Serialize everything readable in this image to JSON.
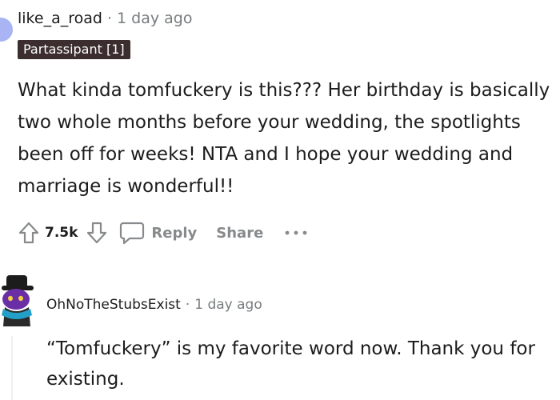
{
  "comment": {
    "username": "like_a_road",
    "separator": "·",
    "time": "1 day ago",
    "flair": "Partassipant [1]",
    "body": "What kinda tomfuckery is this??? Her birthday is basically two whole months before your wedding, the spotlights been off for weeks! NTA and I hope your wedding and marriage is wonderful!!",
    "actions": {
      "upvote_icon": "upvote-arrow-icon",
      "vote_count": "7.5k",
      "downvote_icon": "downvote-arrow-icon",
      "reply_icon": "speech-bubble-icon",
      "reply_label": "Reply",
      "share_label": "Share",
      "more_icon": "more-dots-icon"
    }
  },
  "reply": {
    "username": "OhNoTheStubsExist",
    "separator": "·",
    "time": "1 day ago",
    "body": "“Tomfuckery” is my favorite word now. Thank you for existing.",
    "avatar_icon": "snoo-avatar-icon"
  },
  "colors": {
    "text": "#1c1c1c",
    "muted": "#787c7e",
    "action": "#878a8c",
    "flair_bg": "#3c2e2e",
    "flair_text": "#ffffff",
    "avatar_hat": "#1c1c1c",
    "avatar_face": "#6a2fa6",
    "avatar_scarf": "#24a0c8"
  }
}
